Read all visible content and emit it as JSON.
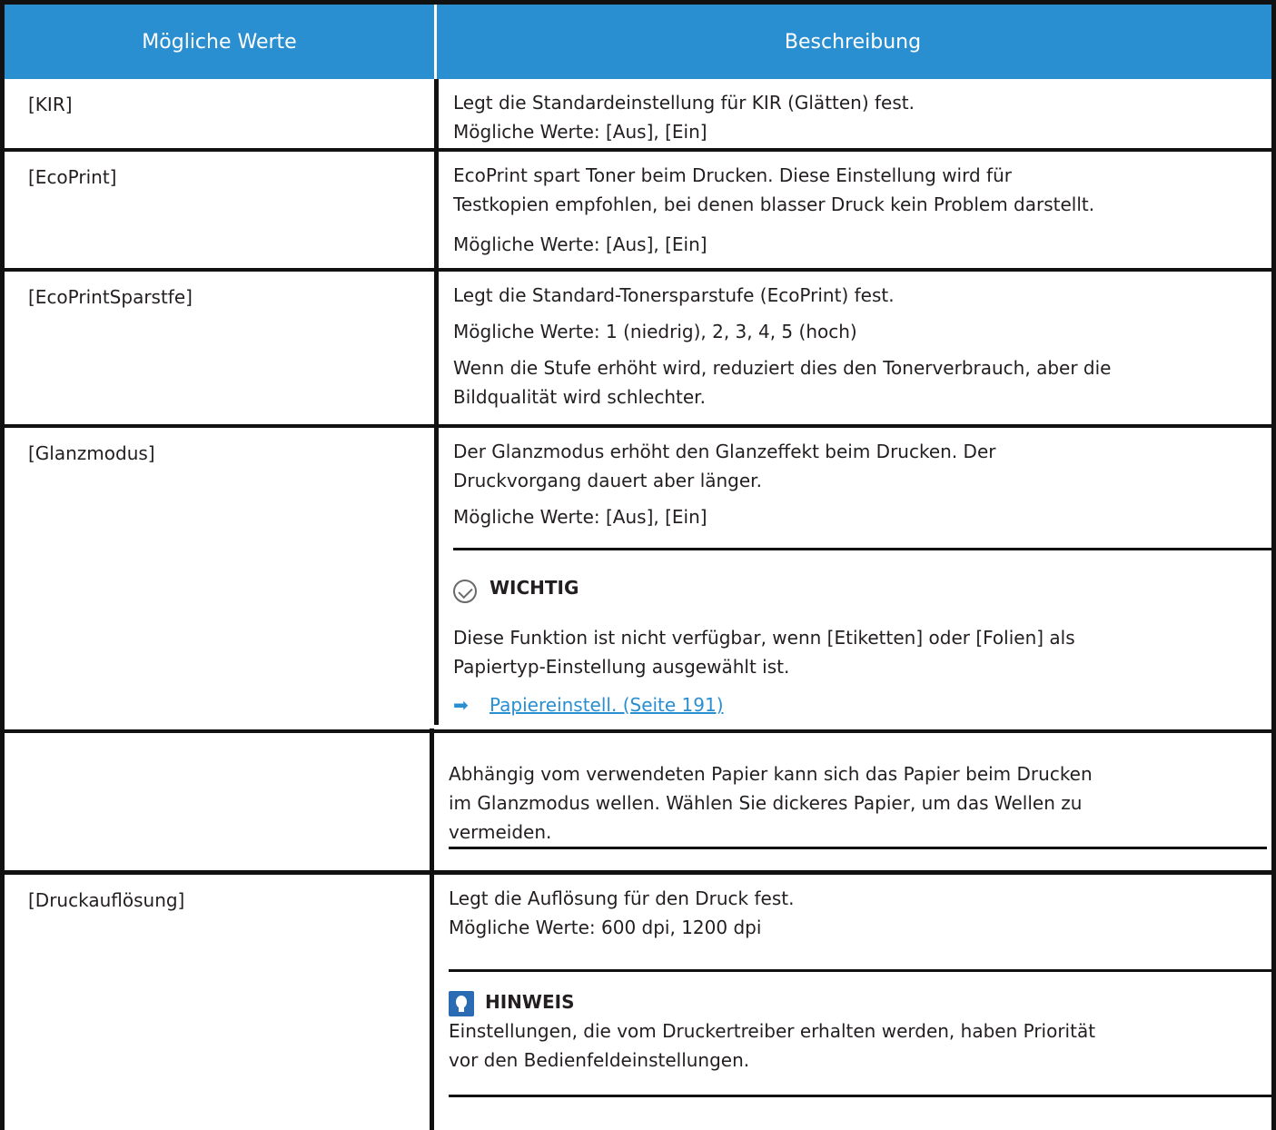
{
  "table": {
    "header": {
      "col1": "Mögliche Werte",
      "col2": "Beschreibung"
    },
    "rows": [
      {
        "key": "[KIR]",
        "desc": [
          "Legt die Standardeinstellung für KIR (Glätten) fest.",
          "Mögliche Werte: [Aus], [Ein]"
        ]
      },
      {
        "key": "[EcoPrint]",
        "desc": [
          "EcoPrint spart Toner beim Drucken. Diese Einstellung wird für",
          "Testkopien empfohlen, bei denen blasser Druck kein Problem darstellt.",
          "Mögliche Werte: [Aus], [Ein]"
        ]
      },
      {
        "key": "[EcoPrintSparstfe]",
        "desc": [
          "Legt die Standard-Tonersparstufe (EcoPrint) fest.",
          "Mögliche Werte: 1 (niedrig), 2, 3, 4, 5 (hoch)",
          "Wenn die Stufe erhöht wird, reduziert dies den Tonerverbrauch, aber die",
          "Bildqualität wird schlechter."
        ]
      },
      {
        "key": "[Glanzmodus]",
        "desc": [
          "Der Glanzmodus erhöht den Glanzeffekt beim Drucken. Der",
          "Druckvorgang dauert aber länger.",
          "Mögliche Werte: [Aus], [Ein]"
        ],
        "note": {
          "title": "WICHTIG",
          "lines1": [
            "Diese Funktion ist nicht verfügbar, wenn [Etiketten] oder [Folien] als",
            "Papiertyp-Einstellung ausgewählt ist."
          ],
          "link": "Papiereinstell. (Seite 191)",
          "lines2": [
            "Abhängig vom verwendeten Papier kann sich das Papier beim Drucken",
            "im Glanzmodus wellen. Wählen Sie dickeres Papier, um das Wellen zu",
            "vermeiden."
          ]
        }
      },
      {
        "key": "[Druckauflösung]",
        "desc": [
          "Legt die Auflösung für den Druck fest.",
          "Mögliche Werte: 600 dpi, 1200 dpi"
        ],
        "note": {
          "title": "HINWEIS",
          "lines": [
            "Einstellungen, die vom Druckertreiber erhalten werden, haben Priorität",
            "vor den Bedienfeldeinstellungen."
          ]
        }
      }
    ]
  }
}
